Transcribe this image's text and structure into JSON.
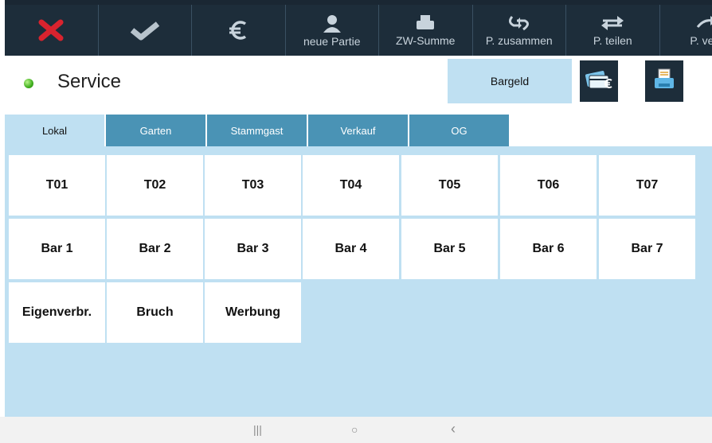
{
  "toolbar": {
    "buttons": [
      {
        "icon": "cancel-x-icon",
        "label": ""
      },
      {
        "icon": "checkmark-icon",
        "label": ""
      },
      {
        "icon": "euro-icon",
        "label": ""
      },
      {
        "icon": "person-icon",
        "label": "neue Partie"
      },
      {
        "icon": "printer-icon",
        "label": "ZW-Summe"
      },
      {
        "icon": "merge-arrows-icon",
        "label": "P. zusammen"
      },
      {
        "icon": "swap-arrows-icon",
        "label": "P. teilen"
      },
      {
        "icon": "move-arrow-icon",
        "label": "P. vers"
      }
    ],
    "colors": {
      "bg": "#1d2d3a",
      "icon": "#c8d3dc",
      "cancel": "#d9232e"
    }
  },
  "header": {
    "status": "online",
    "title": "Service",
    "pay_mode": "Bargeld"
  },
  "tabs": [
    {
      "label": "Lokal",
      "active": true
    },
    {
      "label": "Garten",
      "active": false
    },
    {
      "label": "Stammgast",
      "active": false
    },
    {
      "label": "Verkauf",
      "active": false
    },
    {
      "label": "OG",
      "active": false
    }
  ],
  "tables": {
    "row1": [
      "T01",
      "T02",
      "T03",
      "T04",
      "T05",
      "T06",
      "T07"
    ],
    "row2": [
      "Bar 1",
      "Bar 2",
      "Bar 3",
      "Bar 4",
      "Bar 5",
      "Bar 6",
      "Bar 7"
    ],
    "row3": [
      "Eigenverbr.",
      "Bruch",
      "Werbung"
    ]
  },
  "navbar": {
    "recent": "|||",
    "home": "○",
    "back": "‹"
  }
}
